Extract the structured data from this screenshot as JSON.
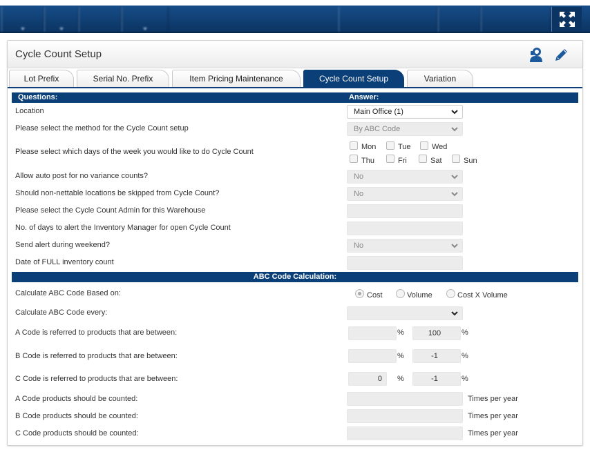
{
  "panel": {
    "title": "Cycle Count Setup"
  },
  "tabs": [
    {
      "label": "Lot Prefix",
      "active": false
    },
    {
      "label": "Serial No. Prefix",
      "active": false
    },
    {
      "label": "Item Pricing Maintenance",
      "active": false
    },
    {
      "label": "Cycle Count Setup",
      "active": true
    },
    {
      "label": "Variation",
      "active": false
    }
  ],
  "questions_header": {
    "questions": "Questions:",
    "answer": "Answer:"
  },
  "questions": {
    "location": {
      "label": "Location",
      "value": "Main Office (1)"
    },
    "method": {
      "label": "Please select the method for the Cycle Count setup",
      "value": "By ABC Code"
    },
    "days": {
      "label": "Please select which days of the week you would like to do Cycle Count",
      "options": [
        "Mon",
        "Tue",
        "Wed",
        "Thu",
        "Fri",
        "Sat",
        "Sun"
      ]
    },
    "auto_post": {
      "label": "Allow auto post for no variance counts?",
      "value": "No"
    },
    "skip_non_nettable": {
      "label": "Should non-nettable locations be skipped from Cycle Count?",
      "value": "No"
    },
    "admin": {
      "label": "Please select the Cycle Count Admin for this Warehouse",
      "value": ""
    },
    "alert_days": {
      "label": "No. of days to alert the Inventory Manager for open Cycle Count",
      "value": ""
    },
    "weekend_alert": {
      "label": "Send alert during weekend?",
      "value": "No"
    },
    "full_count_date": {
      "label": "Date of FULL inventory count",
      "value": ""
    }
  },
  "abc": {
    "header": "ABC Code Calculation:",
    "based_on": {
      "label": "Calculate ABC Code Based on:",
      "options": [
        "Cost",
        "Volume",
        "Cost X Volume"
      ],
      "selected": "Cost"
    },
    "every": {
      "label": "Calculate ABC Code every:",
      "value": ""
    },
    "a_range": {
      "label": "A Code is referred to products that are between:",
      "from": "",
      "to": "100"
    },
    "b_range": {
      "label": "B Code is referred to products that are between:",
      "from": "",
      "to": "-1"
    },
    "c_range": {
      "label": "C Code is referred to products that are between:",
      "from": "0",
      "to": "-1"
    },
    "percent": "%",
    "a_count": {
      "label": "A Code products should be counted:",
      "value": ""
    },
    "b_count": {
      "label": "B Code products should be counted:",
      "value": ""
    },
    "c_count": {
      "label": "C Code products should be counted:",
      "value": ""
    },
    "times_per_year": "Times per year"
  },
  "colors": {
    "nav_bg": "#0b3463",
    "accent": "#0b3f77"
  },
  "icons": {
    "expand": "expand-arrows-icon",
    "person": "user-support-icon",
    "edit": "pencil-icon"
  }
}
